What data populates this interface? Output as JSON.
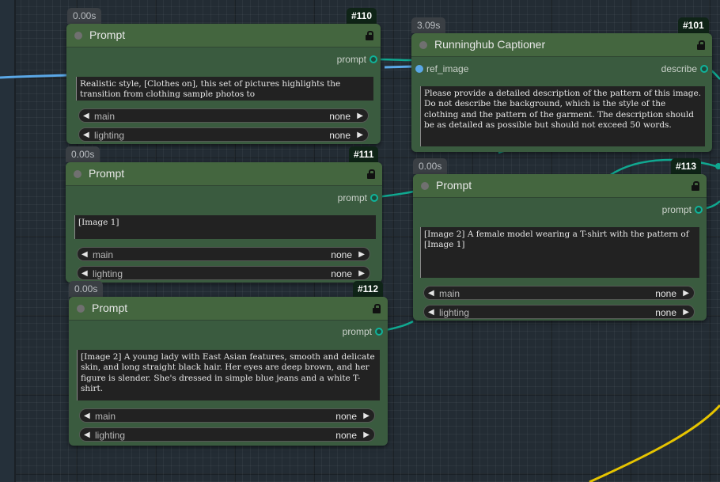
{
  "nodes": {
    "n110": {
      "time": "0.00s",
      "id": "#110",
      "title": "Prompt",
      "output": "prompt",
      "text": "Realistic style, [Clothes on], this set of pictures highlights the transition from clothing sample photos to",
      "main_label": "main",
      "main_value": "none",
      "lighting_label": "lighting",
      "lighting_value": "none"
    },
    "n111": {
      "time": "0.00s",
      "id": "#111",
      "title": "Prompt",
      "output": "prompt",
      "text": "[Image 1]",
      "main_label": "main",
      "main_value": "none",
      "lighting_label": "lighting",
      "lighting_value": "none"
    },
    "n112": {
      "time": "0.00s",
      "id": "#112",
      "title": "Prompt",
      "output": "prompt",
      "text": "[Image 2] A young lady with East Asian features, smooth and delicate skin, and long straight black hair. Her eyes are deep brown, and her figure is slender. She's dressed in simple blue jeans and a white T-shirt.",
      "main_label": "main",
      "main_value": "none",
      "lighting_label": "lighting",
      "lighting_value": "none"
    },
    "n101": {
      "time": "3.09s",
      "id": "#101",
      "title": "Runninghub Captioner",
      "input": "ref_image",
      "output": "describe",
      "text": "Please provide a detailed description of the pattern of this image. Do not describe the background, which is the style of the clothing and the pattern of the garment. The description should be as detailed as possible but should not exceed 50 words."
    },
    "n113": {
      "time": "0.00s",
      "id": "#113",
      "title": "Prompt",
      "output": "prompt",
      "text": "[Image 2] A female model wearing a T-shirt with the pattern of [Image 1]",
      "main_label": "main",
      "main_value": "none",
      "lighting_label": "lighting",
      "lighting_value": "none"
    }
  },
  "colors": {
    "link_prompt": "#10a890",
    "link_image": "#5aa7e6",
    "link_yellow": "#e6c400"
  },
  "icons": {
    "lock": "lock-icon",
    "combo_left": "◀",
    "combo_right": "▶"
  }
}
